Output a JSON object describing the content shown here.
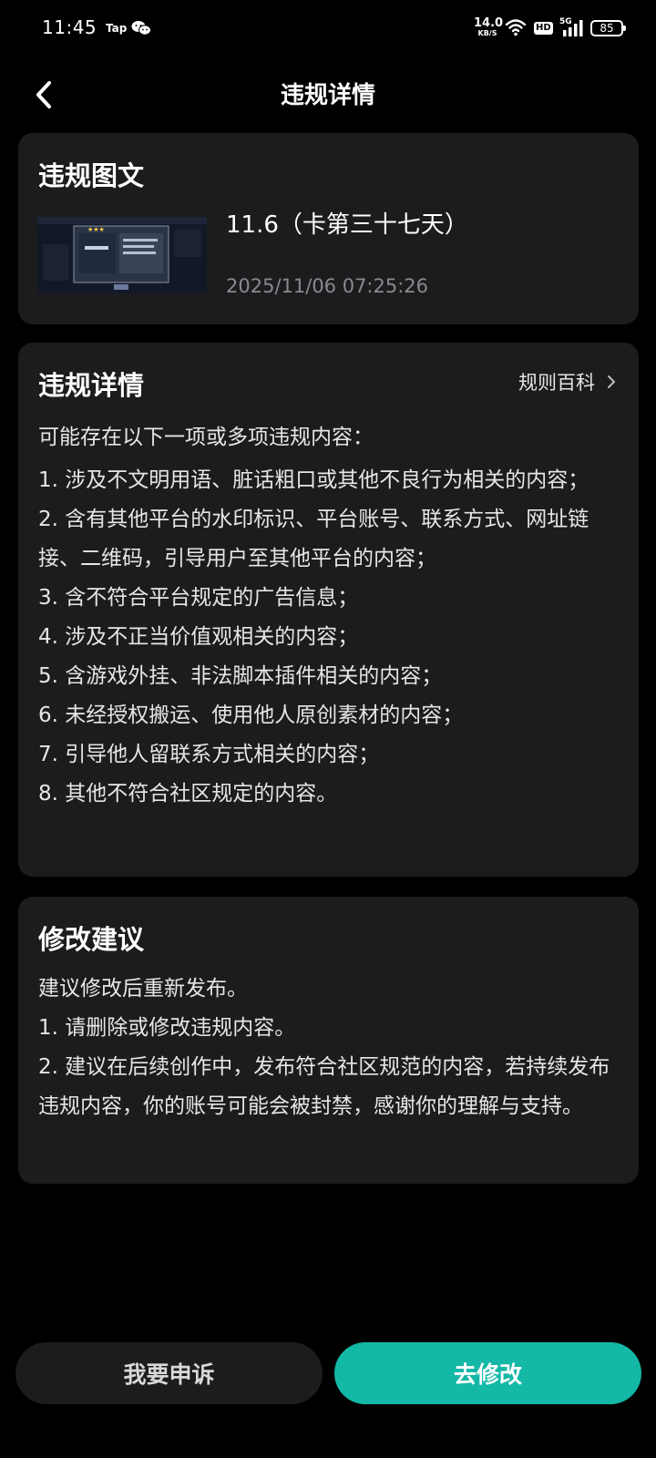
{
  "status_bar": {
    "time": "11:45",
    "tap_label": "Tap",
    "speed_value": "14.0",
    "speed_unit": "KB/S",
    "hd_label": "HD",
    "network_label": "5G",
    "battery": "85",
    "icons": [
      "wechat-icon",
      "wifi-icon",
      "signal-icon",
      "battery-icon"
    ]
  },
  "header": {
    "title": "违规详情"
  },
  "post_card": {
    "title": "违规图文",
    "post_title": "11.6（卡第三十七天）",
    "post_time": "2025/11/06 07:25:26"
  },
  "details_card": {
    "title": "违规详情",
    "rules_link": "规则百科",
    "intro": "可能存在以下一项或多项违规内容：",
    "items": [
      "1. 涉及不文明用语、脏话粗口或其他不良行为相关的内容；",
      "2. 含有其他平台的水印标识、平台账号、联系方式、网址链接、二维码，引导用户至其他平台的内容；",
      "3. 含不符合平台规定的广告信息；",
      "4. 涉及不正当价值观相关的内容；",
      "5. 含游戏外挂、非法脚本插件相关的内容；",
      "6. 未经授权搬运、使用他人原创素材的内容；",
      "7. 引导他人留联系方式相关的内容；",
      "8. 其他不符合社区规定的内容。"
    ]
  },
  "suggest_card": {
    "title": "修改建议",
    "lines": [
      "建议修改后重新发布。",
      "1. 请删除或修改违规内容。",
      "2. 建议在后续创作中，发布符合社区规范的内容，若持续发布违规内容，你的账号可能会被封禁，感谢你的理解与支持。"
    ]
  },
  "actions": {
    "appeal_label": "我要申诉",
    "modify_label": "去修改"
  },
  "colors": {
    "background": "#000000",
    "card": "#1c1c1e",
    "accent": "#14b8a6",
    "muted_text": "#8a8a8e"
  }
}
